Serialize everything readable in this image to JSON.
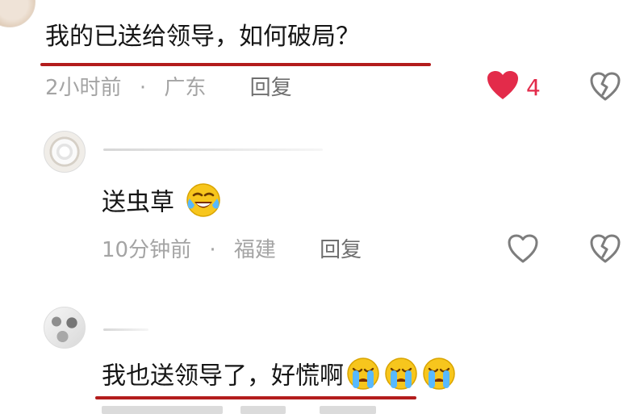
{
  "comment_main": {
    "text": "我的已送给领导，如何破局？",
    "time": "2小时前",
    "separator": "·",
    "location": "广东",
    "reply_label": "回复",
    "like_count": "4",
    "liked": true,
    "accent_color": "#e32b4a",
    "underline_color": "#b31c1c"
  },
  "reply_1": {
    "text": "送虫草",
    "emoji": "face-with-tears-of-joy",
    "time": "10分钟前",
    "separator": "·",
    "location": "福建",
    "reply_label": "回复"
  },
  "reply_2": {
    "text": "我也送领导了，好慌啊",
    "emoji": "loudly-crying-face",
    "emoji_count": 3
  }
}
